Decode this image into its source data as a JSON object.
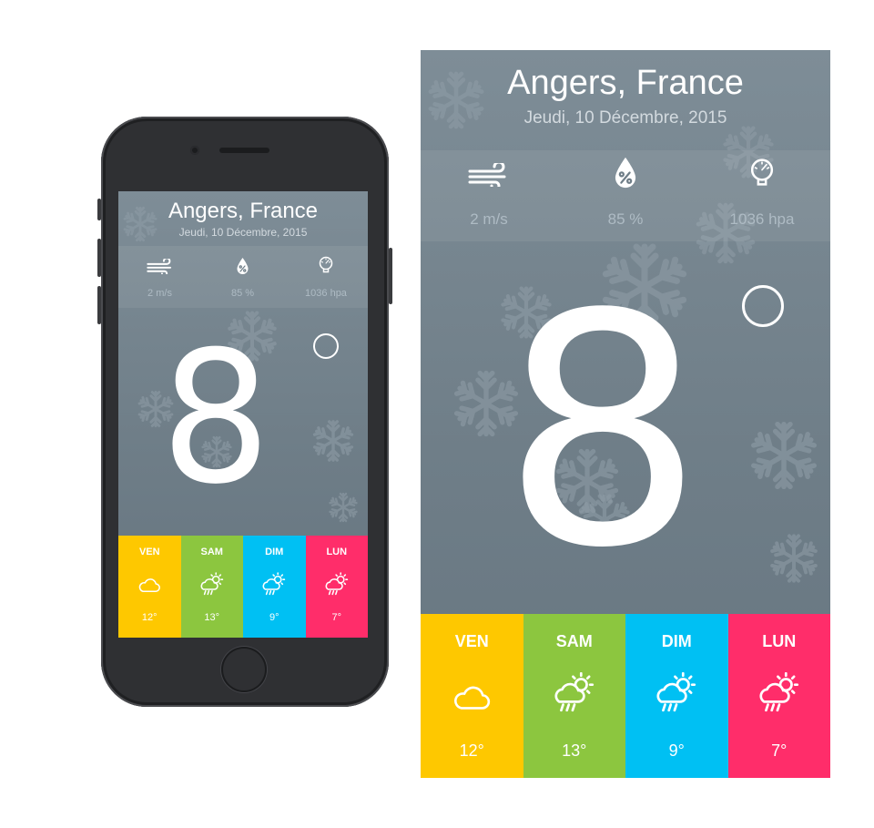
{
  "location": {
    "city": "Angers, France",
    "date": "Jeudi, 10 Décembre, 2015"
  },
  "stats": [
    {
      "icon": "wind-icon",
      "value": "2 m/s"
    },
    {
      "icon": "humidity-icon",
      "value": "85 %"
    },
    {
      "icon": "pressure-gauge-icon",
      "value": "1036 hpa"
    }
  ],
  "current": {
    "temperature": "8",
    "weather_icon": "snowflake-icon"
  },
  "forecast": [
    {
      "day": "VEN",
      "temp": "12°",
      "icon": "cloud-icon",
      "color": "#fec800"
    },
    {
      "day": "SAM",
      "temp": "13°",
      "icon": "sun-cloud-rain-icon",
      "color": "#8cc63f"
    },
    {
      "day": "DIM",
      "temp": "9°",
      "icon": "sun-cloud-rain-icon",
      "color": "#00c0f3"
    },
    {
      "day": "LUN",
      "temp": "7°",
      "icon": "sun-cloud-rain-icon",
      "color": "#ff2d6a"
    }
  ],
  "colors": {
    "background": "#75848e",
    "text": "#ffffff"
  }
}
